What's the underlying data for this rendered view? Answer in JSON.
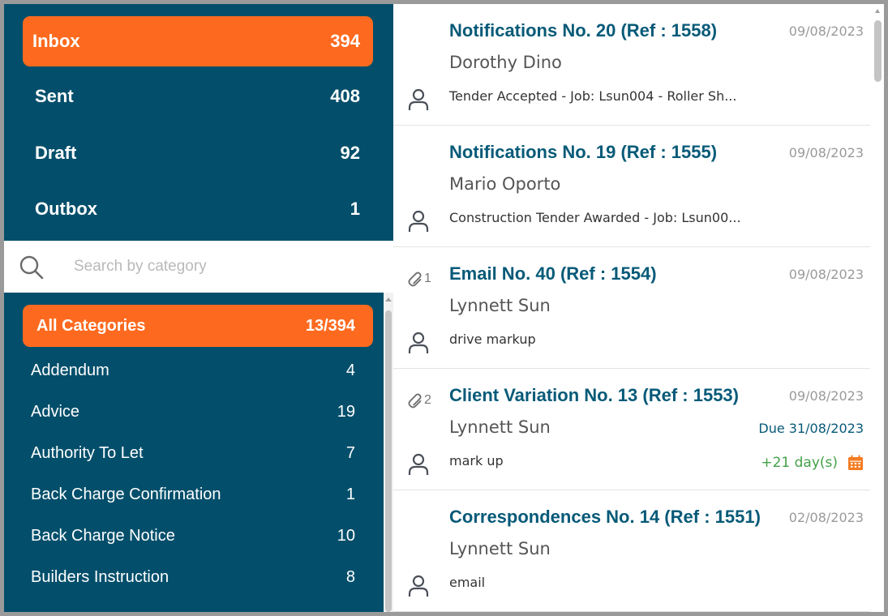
{
  "folders": [
    {
      "label": "Inbox",
      "count": "394"
    },
    {
      "label": "Sent",
      "count": "408"
    },
    {
      "label": "Draft",
      "count": "92"
    },
    {
      "label": "Outbox",
      "count": "1"
    }
  ],
  "search": {
    "placeholder": "Search by category"
  },
  "categories": {
    "all": {
      "label": "All Categories",
      "count": "13/394"
    },
    "items": [
      {
        "label": "Addendum",
        "count": "4"
      },
      {
        "label": "Advice",
        "count": "19"
      },
      {
        "label": "Authority To Let",
        "count": "7"
      },
      {
        "label": "Back Charge Confirmation",
        "count": "1"
      },
      {
        "label": "Back Charge Notice",
        "count": "10"
      },
      {
        "label": "Builders Instruction",
        "count": "8"
      }
    ]
  },
  "messages": [
    {
      "title": "Notifications No. 20 (Ref : 1558)",
      "date": "09/08/2023",
      "sender": "Dorothy Dino",
      "subject": "Tender Accepted - Job: Lsun004 - Roller Sh..."
    },
    {
      "title": "Notifications No. 19 (Ref : 1555)",
      "date": "09/08/2023",
      "sender": "Mario Oporto",
      "subject": "Construction Tender Awarded - Job: Lsun00..."
    },
    {
      "title": "Email No. 40 (Ref : 1554)",
      "date": "09/08/2023",
      "sender": "Lynnett Sun",
      "subject": "drive markup",
      "attachments": "1"
    },
    {
      "title": "Client Variation No. 13 (Ref : 1553)",
      "date": "09/08/2023",
      "sender": "Lynnett Sun",
      "subject": "mark up",
      "attachments": "2",
      "due": "Due 31/08/2023",
      "days": "+21 day(s)"
    },
    {
      "title": "Correspondences No. 14 (Ref : 1551)",
      "date": "02/08/2023",
      "sender": "Lynnett Sun",
      "subject": "email"
    }
  ],
  "colors": {
    "accent": "#fd6a1f",
    "panel": "#034f6b",
    "title": "#075a78",
    "days": "#43a047"
  }
}
